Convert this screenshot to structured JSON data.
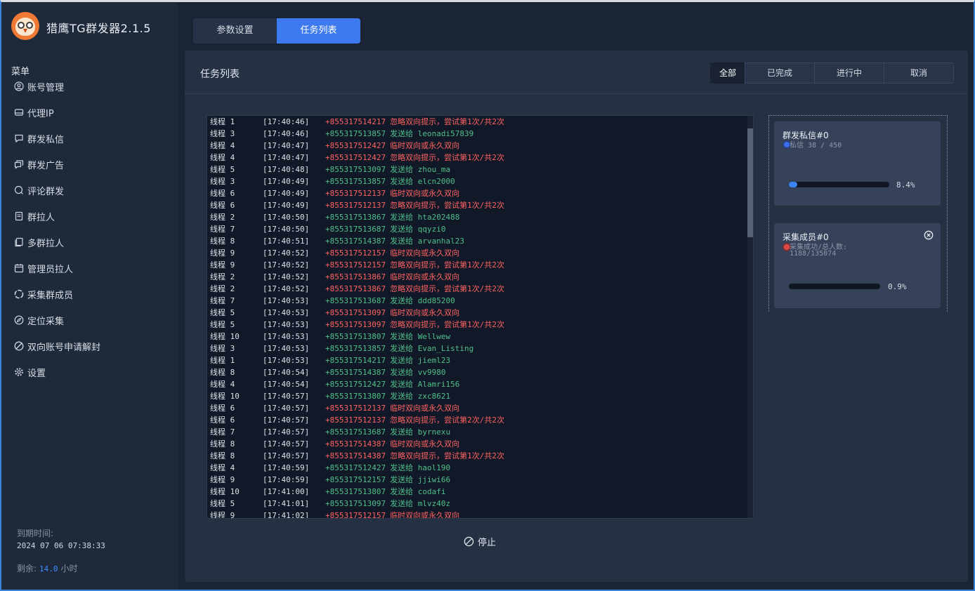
{
  "app": {
    "title": "猎鹰TG群发器2.1.5"
  },
  "sidebar": {
    "menu_heading": "菜单",
    "items": [
      {
        "label": "账号管理",
        "icon": "user-circle-icon"
      },
      {
        "label": "代理IP",
        "icon": "drive-icon"
      },
      {
        "label": "群发私信",
        "icon": "chat-bubble-icon"
      },
      {
        "label": "群发广告",
        "icon": "chat-bubbles-icon"
      },
      {
        "label": "评论群发",
        "icon": "comment-icon"
      },
      {
        "label": "群拉人",
        "icon": "document-icon"
      },
      {
        "label": "多群拉人",
        "icon": "documents-icon"
      },
      {
        "label": "管理员拉人",
        "icon": "calendar-icon"
      },
      {
        "label": "采集群成员",
        "icon": "ring-icon"
      },
      {
        "label": "定位采集",
        "icon": "compass-icon"
      },
      {
        "label": "双向账号申请解封",
        "icon": "ban-icon"
      },
      {
        "label": "设置",
        "icon": "gear-icon"
      }
    ],
    "expiry_label": "到期时间:",
    "expiry_value": "2024 07 06 07:38:33",
    "remaining_label": "剩余:",
    "remaining_value": "14.0",
    "remaining_unit": "小时"
  },
  "tabs": [
    {
      "label": "参数设置",
      "active": false
    },
    {
      "label": "任务列表",
      "active": true
    }
  ],
  "panel": {
    "title": "任务列表",
    "filters": [
      "全部",
      "已完成",
      "进行中",
      "取消"
    ],
    "active_filter": "全部",
    "stop_label": "停止"
  },
  "log": [
    {
      "thread": "线程 1",
      "time": "[17:40:46]",
      "phone": "+855317514217",
      "msg": "忽略双向提示，尝试第1次/共2次",
      "status": "err"
    },
    {
      "thread": "线程 3",
      "time": "[17:40:46]",
      "phone": "+855317513857",
      "msg": "发送给 leonadi57839",
      "status": "ok"
    },
    {
      "thread": "线程 4",
      "time": "[17:40:47]",
      "phone": "+855317512427",
      "msg": "临时双向或永久双向",
      "status": "err"
    },
    {
      "thread": "线程 4",
      "time": "[17:40:47]",
      "phone": "+855317512427",
      "msg": "忽略双向提示，尝试第1次/共2次",
      "status": "err"
    },
    {
      "thread": "线程 5",
      "time": "[17:40:48]",
      "phone": "+855317513097",
      "msg": "发送给 zhou_ma",
      "status": "ok"
    },
    {
      "thread": "线程 3",
      "time": "[17:40:49]",
      "phone": "+855317513857",
      "msg": "发送给 elcn2000",
      "status": "ok"
    },
    {
      "thread": "线程 6",
      "time": "[17:40:49]",
      "phone": "+855317512137",
      "msg": "临时双向或永久双向",
      "status": "err"
    },
    {
      "thread": "线程 6",
      "time": "[17:40:49]",
      "phone": "+855317512137",
      "msg": "忽略双向提示，尝试第1次/共2次",
      "status": "err"
    },
    {
      "thread": "线程 2",
      "time": "[17:40:50]",
      "phone": "+855317513867",
      "msg": "发送给 hta202488",
      "status": "ok"
    },
    {
      "thread": "线程 7",
      "time": "[17:40:50]",
      "phone": "+855317513687",
      "msg": "发送给 qqyzi0",
      "status": "ok"
    },
    {
      "thread": "线程 8",
      "time": "[17:40:51]",
      "phone": "+855317514387",
      "msg": "发送给 arvanhal23",
      "status": "ok"
    },
    {
      "thread": "线程 9",
      "time": "[17:40:52]",
      "phone": "+855317512157",
      "msg": "临时双向或永久双向",
      "status": "err"
    },
    {
      "thread": "线程 9",
      "time": "[17:40:52]",
      "phone": "+855317512157",
      "msg": "忽略双向提示，尝试第1次/共2次",
      "status": "err"
    },
    {
      "thread": "线程 2",
      "time": "[17:40:52]",
      "phone": "+855317513867",
      "msg": "临时双向或永久双向",
      "status": "err"
    },
    {
      "thread": "线程 2",
      "time": "[17:40:52]",
      "phone": "+855317513867",
      "msg": "忽略双向提示，尝试第1次/共2次",
      "status": "err"
    },
    {
      "thread": "线程 7",
      "time": "[17:40:53]",
      "phone": "+855317513687",
      "msg": "发送给 ddd85200",
      "status": "ok"
    },
    {
      "thread": "线程 5",
      "time": "[17:40:53]",
      "phone": "+855317513097",
      "msg": "临时双向或永久双向",
      "status": "err"
    },
    {
      "thread": "线程 5",
      "time": "[17:40:53]",
      "phone": "+855317513097",
      "msg": "忽略双向提示，尝试第1次/共2次",
      "status": "err"
    },
    {
      "thread": "线程 10",
      "time": "[17:40:53]",
      "phone": "+855317513807",
      "msg": "发送给 Wellwew",
      "status": "ok"
    },
    {
      "thread": "线程 3",
      "time": "[17:40:53]",
      "phone": "+855317513857",
      "msg": "发送给 Evan_Listing",
      "status": "ok"
    },
    {
      "thread": "线程 1",
      "time": "[17:40:53]",
      "phone": "+855317514217",
      "msg": "发送给 jieml23",
      "status": "ok"
    },
    {
      "thread": "线程 8",
      "time": "[17:40:54]",
      "phone": "+855317514387",
      "msg": "发送给 vv9980",
      "status": "ok"
    },
    {
      "thread": "线程 4",
      "time": "[17:40:54]",
      "phone": "+855317512427",
      "msg": "发送给 Alamri156",
      "status": "ok"
    },
    {
      "thread": "线程 10",
      "time": "[17:40:57]",
      "phone": "+855317513807",
      "msg": "发送给 zxc8621",
      "status": "ok"
    },
    {
      "thread": "线程 6",
      "time": "[17:40:57]",
      "phone": "+855317512137",
      "msg": "临时双向或永久双向",
      "status": "err"
    },
    {
      "thread": "线程 6",
      "time": "[17:40:57]",
      "phone": "+855317512137",
      "msg": "忽略双向提示，尝试第2次/共2次",
      "status": "err"
    },
    {
      "thread": "线程 7",
      "time": "[17:40:57]",
      "phone": "+855317513687",
      "msg": "发送给 byrnexu",
      "status": "ok"
    },
    {
      "thread": "线程 8",
      "time": "[17:40:57]",
      "phone": "+855317514387",
      "msg": "临时双向或永久双向",
      "status": "err"
    },
    {
      "thread": "线程 8",
      "time": "[17:40:57]",
      "phone": "+855317514387",
      "msg": "忽略双向提示，尝试第1次/共2次",
      "status": "err"
    },
    {
      "thread": "线程 4",
      "time": "[17:40:59]",
      "phone": "+855317512427",
      "msg": "发送给 haol190",
      "status": "ok"
    },
    {
      "thread": "线程 9",
      "time": "[17:40:59]",
      "phone": "+855317512157",
      "msg": "发送给 jjiwi66",
      "status": "ok"
    },
    {
      "thread": "线程 10",
      "time": "[17:41:00]",
      "phone": "+855317513807",
      "msg": "发送给 codafi",
      "status": "ok"
    },
    {
      "thread": "线程 5",
      "time": "[17:41:01]",
      "phone": "+855317513097",
      "msg": "发送给 mlvz40z",
      "status": "ok"
    },
    {
      "thread": "线程 9",
      "time": "[17:41:02]",
      "phone": "+855317512157",
      "msg": "临时双向或永久双向",
      "status": "err"
    }
  ],
  "tasks": [
    {
      "title": "群发私信#0",
      "sub": "私信 38 / 450",
      "progress_fraction": 0.084,
      "progress_label": "8.4%",
      "dot_color": "#3b6cf0"
    },
    {
      "title": "采集成员#0",
      "sub": "采集成功/总人数:",
      "sub2": "1188/135074",
      "progress_fraction": 0.009,
      "progress_label": "0.9%",
      "dot_color": "#e04848"
    }
  ]
}
